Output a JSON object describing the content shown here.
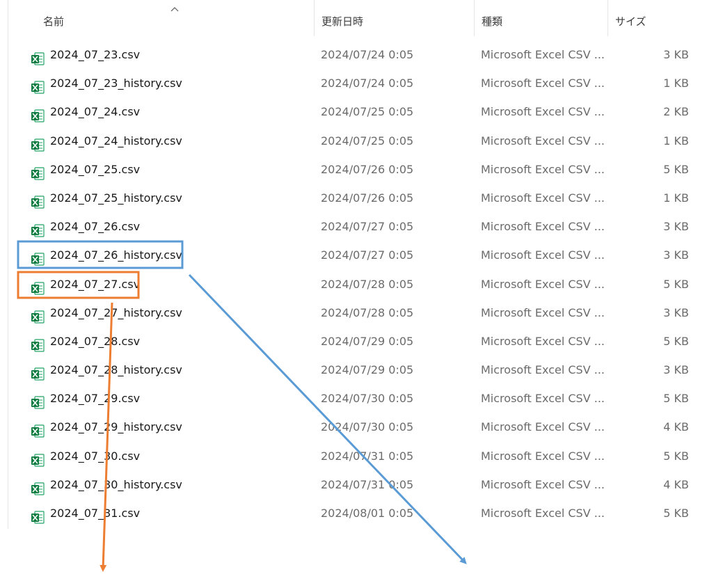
{
  "header": {
    "name": "名前",
    "date": "更新日時",
    "type": "種類",
    "size": "サイズ"
  },
  "sort": {
    "column": "name",
    "direction": "ascending",
    "icon": "chevron-up-icon"
  },
  "file_icon": "excel-csv-icon",
  "files": [
    {
      "name": "2024_07_23.csv",
      "date": "2024/07/24 0:05",
      "type": "Microsoft Excel CSV ...",
      "size": "3 KB"
    },
    {
      "name": "2024_07_23_history.csv",
      "date": "2024/07/24 0:05",
      "type": "Microsoft Excel CSV ...",
      "size": "1 KB"
    },
    {
      "name": "2024_07_24.csv",
      "date": "2024/07/25 0:05",
      "type": "Microsoft Excel CSV ...",
      "size": "2 KB"
    },
    {
      "name": "2024_07_24_history.csv",
      "date": "2024/07/25 0:05",
      "type": "Microsoft Excel CSV ...",
      "size": "1 KB"
    },
    {
      "name": "2024_07_25.csv",
      "date": "2024/07/26 0:05",
      "type": "Microsoft Excel CSV ...",
      "size": "5 KB"
    },
    {
      "name": "2024_07_25_history.csv",
      "date": "2024/07/26 0:05",
      "type": "Microsoft Excel CSV ...",
      "size": "1 KB"
    },
    {
      "name": "2024_07_26.csv",
      "date": "2024/07/27 0:05",
      "type": "Microsoft Excel CSV ...",
      "size": "3 KB"
    },
    {
      "name": "2024_07_26_history.csv",
      "date": "2024/07/27 0:05",
      "type": "Microsoft Excel CSV ...",
      "size": "3 KB"
    },
    {
      "name": "2024_07_27.csv",
      "date": "2024/07/28 0:05",
      "type": "Microsoft Excel CSV ...",
      "size": "5 KB"
    },
    {
      "name": "2024_07_27_history.csv",
      "date": "2024/07/28 0:05",
      "type": "Microsoft Excel CSV ...",
      "size": "3 KB"
    },
    {
      "name": "2024_07_28.csv",
      "date": "2024/07/29 0:05",
      "type": "Microsoft Excel CSV ...",
      "size": "5 KB"
    },
    {
      "name": "2024_07_28_history.csv",
      "date": "2024/07/29 0:05",
      "type": "Microsoft Excel CSV ...",
      "size": "3 KB"
    },
    {
      "name": "2024_07_29.csv",
      "date": "2024/07/30 0:05",
      "type": "Microsoft Excel CSV ...",
      "size": "5 KB"
    },
    {
      "name": "2024_07_29_history.csv",
      "date": "2024/07/30 0:05",
      "type": "Microsoft Excel CSV ...",
      "size": "4 KB"
    },
    {
      "name": "2024_07_30.csv",
      "date": "2024/07/31 0:05",
      "type": "Microsoft Excel CSV ...",
      "size": "5 KB"
    },
    {
      "name": "2024_07_30_history.csv",
      "date": "2024/07/31 0:05",
      "type": "Microsoft Excel CSV ...",
      "size": "4 KB"
    },
    {
      "name": "2024_07_31.csv",
      "date": "2024/08/01 0:05",
      "type": "Microsoft Excel CSV ...",
      "size": "5 KB"
    }
  ],
  "annotations": {
    "blue_box": {
      "target": "2024_07_26_history.csv",
      "color": "#5b9bd5"
    },
    "orange_box": {
      "target": "2024_07_27.csv",
      "color": "#ed7d31"
    },
    "blue_arrow": {
      "color": "#5b9bd5",
      "icon": "arrow-down-right-icon"
    },
    "orange_arrow": {
      "color": "#ed7d31",
      "icon": "arrow-down-icon"
    }
  }
}
